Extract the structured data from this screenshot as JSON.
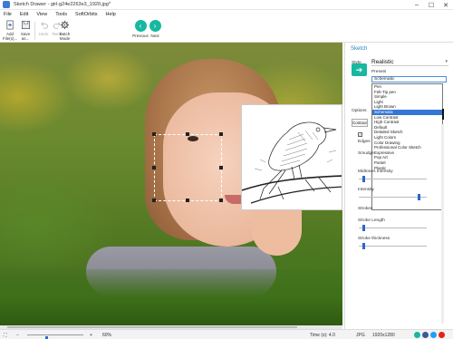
{
  "window": {
    "title": "Sketch Drawer - girl-g24e2263e3_1920.jpg*"
  },
  "menu": [
    "File",
    "Edit",
    "View",
    "Tools",
    "SoftOrbits",
    "Help"
  ],
  "toolbar": {
    "add_files": "Add File(s)...",
    "save_as": "Save as...",
    "undo": "Undo",
    "redo": "Redo",
    "batch_mode": "Batch Mode",
    "previous": "Previous",
    "next": "Next"
  },
  "panel": {
    "title": "Sketch",
    "style_label": "Style",
    "style_value": "Realistic",
    "presets_label": "Presets",
    "preset_selected": "Schematic",
    "preset_options": [
      "Pen",
      "Felt-Tip pen",
      "Simple",
      "Light",
      "Light Brown",
      "Schematic",
      "Low Contrast",
      "High Contrast",
      "Default",
      "Detailed Sketch",
      "Light Colors",
      "Color Drawing",
      "Professional Color Sketch",
      "Expressive",
      "Pop Art",
      "Pastel",
      "Plastic"
    ],
    "options_label": "Options",
    "contour_tab": "Contour",
    "edges_label": "Edges",
    "smudge_label": "Smudge",
    "midtones_label": "Midtones Intensity",
    "midtones_level": 0.05,
    "intensity_label": "Intensity",
    "intensity_level": 0.9,
    "strokes_label": "Strokes",
    "stroke_length_label": "Stroke Length",
    "stroke_length_level": 0.05,
    "stroke_thickness_label": "Stroke thickness",
    "stroke_thickness_level": 0.05
  },
  "status": {
    "zoom": "60%",
    "time": "Time (s): 4.0",
    "format": "JPG",
    "dimensions": "1920x1280",
    "zoom_level": 0.33
  },
  "colors": {
    "accent": "#17b8a0",
    "selection": "#3476d4",
    "link": "#2a7fc8"
  },
  "social_icons": [
    "ok-icon",
    "facebook-icon",
    "twitter-icon",
    "youtube-icon"
  ]
}
